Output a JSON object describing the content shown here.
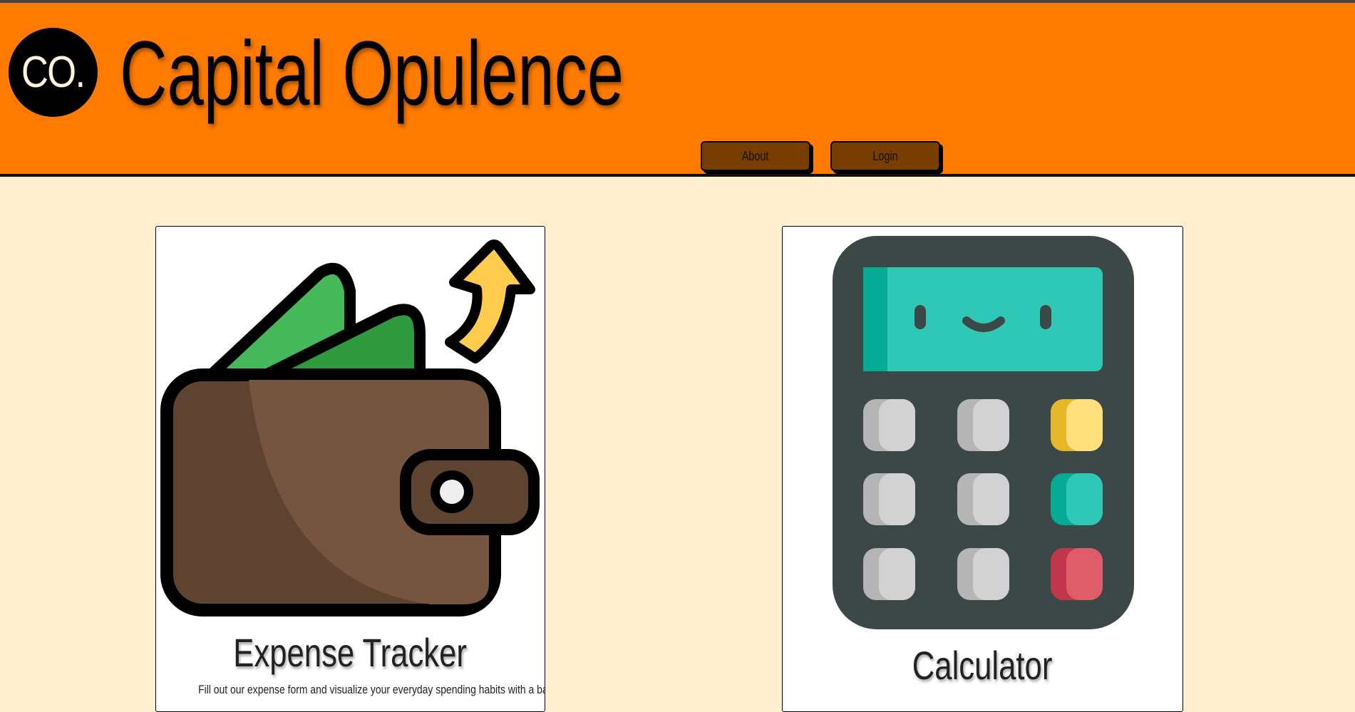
{
  "header": {
    "logo_text": "CO.",
    "title": "Capital Opulence",
    "background": "#ff7b00"
  },
  "nav": {
    "about_label": "About",
    "login_label": "Login"
  },
  "cards": [
    {
      "icon": "wallet-icon",
      "title": "Expense Tracker",
      "description": "Fill out our expense form and visualize your everyday spending habits with a bar graph."
    },
    {
      "icon": "calculator-icon",
      "title": "Calculator",
      "description": ""
    }
  ],
  "colors": {
    "page_background": "#ffefcf",
    "nav_button": "#7a3d00"
  }
}
